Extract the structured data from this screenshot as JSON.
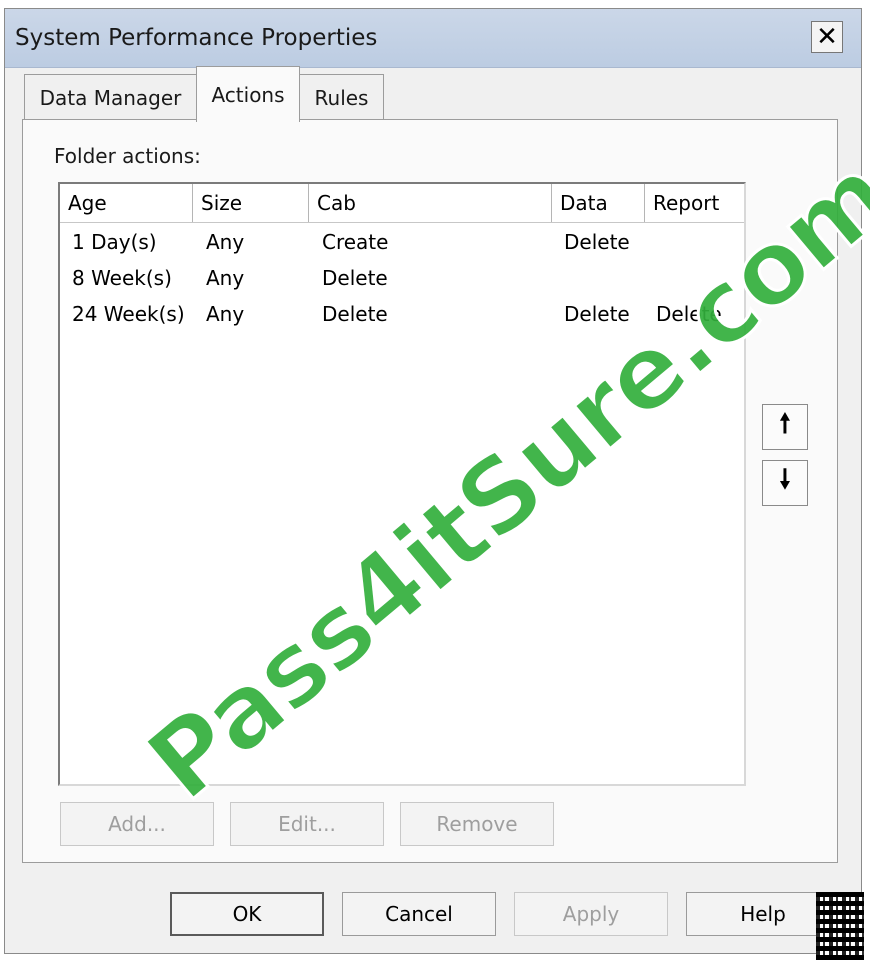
{
  "window": {
    "title": "System Performance Properties",
    "close_symbol": "✕"
  },
  "tabs": [
    {
      "label": "Data Manager"
    },
    {
      "label": "Actions"
    },
    {
      "label": "Rules"
    }
  ],
  "panel": {
    "group_label": "Folder actions:",
    "columns": [
      "Age",
      "Size",
      "Cab",
      "Data",
      "Report"
    ],
    "rows": [
      {
        "age": "1 Day(s)",
        "size": "Any",
        "cab": "Create",
        "data": "Delete",
        "report": ""
      },
      {
        "age": "8 Week(s)",
        "size": "Any",
        "cab": "Delete",
        "data": "",
        "report": ""
      },
      {
        "age": "24 Week(s)",
        "size": "Any",
        "cab": "Delete",
        "data": "Delete",
        "report": "Delete"
      }
    ],
    "move_up_symbol": "🠕",
    "move_down_symbol": "🠗",
    "buttons": {
      "add": "Add...",
      "edit": "Edit...",
      "remove": "Remove"
    }
  },
  "footer_buttons": {
    "ok": "OK",
    "cancel": "Cancel",
    "apply": "Apply",
    "help": "Help"
  },
  "watermark": "Pass4itSure.com"
}
